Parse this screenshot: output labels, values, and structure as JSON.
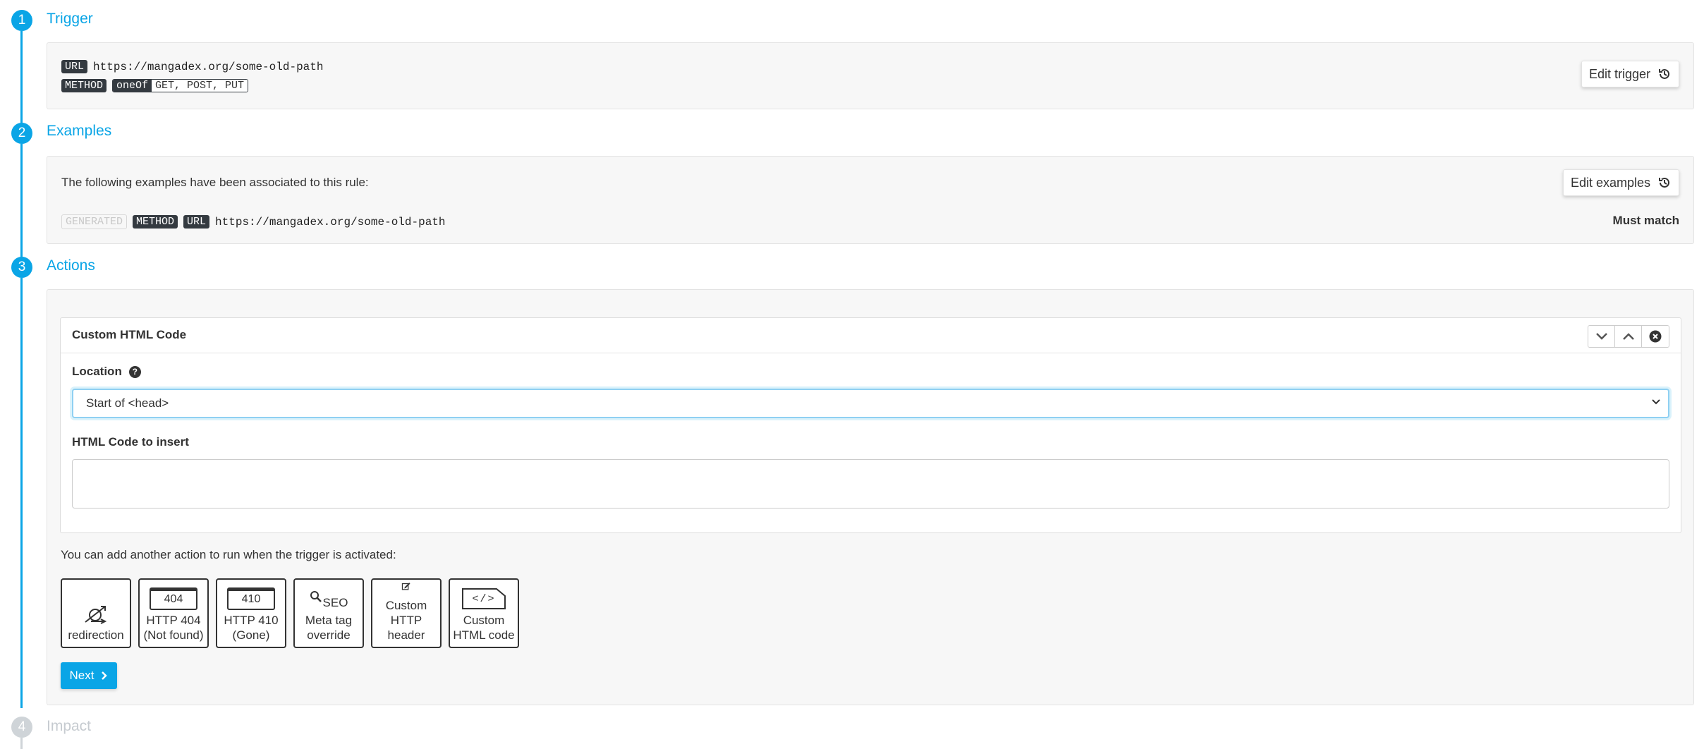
{
  "steps": [
    {
      "number": "1",
      "title": "Trigger"
    },
    {
      "number": "2",
      "title": "Examples"
    },
    {
      "number": "3",
      "title": "Actions"
    },
    {
      "number": "4",
      "title": "Impact"
    }
  ],
  "trigger": {
    "url_tag": "URL",
    "url_value": "https://mangadex.org/some-old-path",
    "method_tag": "METHOD",
    "oneof_tag": "oneOf",
    "methods_value": "GET, POST, PUT",
    "edit_button": "Edit trigger"
  },
  "examples": {
    "intro": "The following examples have been associated to this rule:",
    "edit_button": "Edit examples",
    "row": {
      "generated_tag": "GENERATED",
      "method_tag": "METHOD",
      "url_tag": "URL",
      "url_value": "https://mangadex.org/some-old-path",
      "status": "Must match"
    }
  },
  "action_card": {
    "title": "Custom HTML Code",
    "location_label": "Location",
    "location_help": "?",
    "location_value": "Start of <head>",
    "html_label": "HTML Code to insert",
    "html_value": ""
  },
  "add_action": {
    "prompt": "You can add another action to run when the trigger is activated:",
    "tiles": [
      {
        "label": "redirection",
        "icon": "redirection-icon"
      },
      {
        "label": "HTTP 404\n(Not found)",
        "badge": "404",
        "icon": "browser-window-icon"
      },
      {
        "label": "HTTP 410\n(Gone)",
        "badge": "410",
        "icon": "browser-window-icon"
      },
      {
        "label": "Meta tag\noverride",
        "badge": "SEO",
        "icon": "search-icon"
      },
      {
        "label": "Custom\nHTTP header",
        "icon": "edit-icon"
      },
      {
        "label": "Custom\nHTML code",
        "badge": "</>",
        "icon": "code-file-icon"
      }
    ]
  },
  "next_button": "Next",
  "colors": {
    "accent": "#0aa5e6",
    "dark_tag": "#343a40",
    "inactive": "#cfd4d8"
  }
}
